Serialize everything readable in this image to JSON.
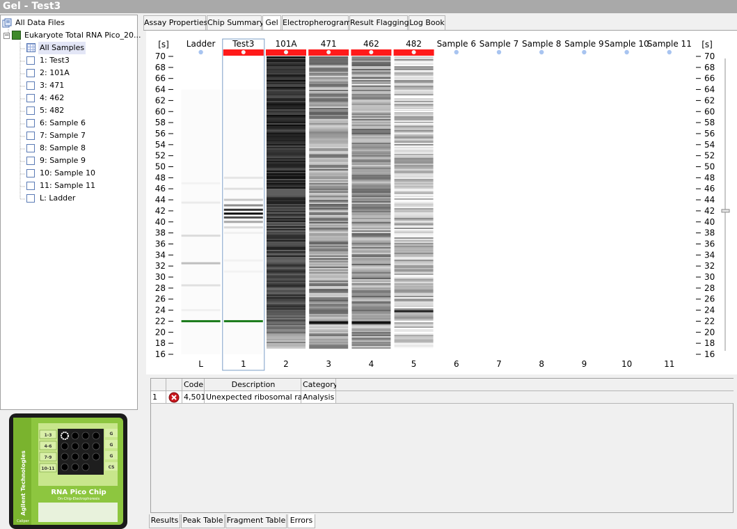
{
  "window": {
    "title": "Gel - Test3"
  },
  "tree": {
    "root": "All Data Files",
    "file": "Eukaryote Total RNA Pico_20...",
    "items": [
      "All Samples",
      "1: Test3",
      "2: 101A",
      "3: 471",
      "4: 462",
      "5: 482",
      "6: Sample 6",
      "7: Sample 7",
      "8: Sample 8",
      "9: Sample 9",
      "10: Sample 10",
      "11: Sample 11",
      "L: Ladder"
    ],
    "selected_index": 0
  },
  "chip": {
    "brand": "Agilent Technologies",
    "product": "RNA Pico Chip",
    "subtitle": "On-Chip-Electrophoresis",
    "maker": "Caliper",
    "well_labels": [
      "1-3",
      "4-6",
      "7-9",
      "10-11"
    ],
    "right_labels": [
      "G",
      "G",
      "G",
      "CS"
    ]
  },
  "top_tabs": [
    "Assay Properties",
    "Chip Summary",
    "Gel",
    "Electropherogram",
    "Result Flagging",
    "Log Book"
  ],
  "active_top_tab": "Gel",
  "gel": {
    "unit_label": "[s]",
    "y_range": [
      16,
      70
    ],
    "y_ticks": [
      70,
      68,
      66,
      64,
      62,
      60,
      58,
      56,
      54,
      52,
      50,
      48,
      46,
      44,
      42,
      40,
      38,
      36,
      34,
      32,
      30,
      28,
      26,
      24,
      22,
      20,
      18,
      16
    ],
    "slider_value": 42,
    "lanes": [
      {
        "name": "Ladder",
        "number": "L",
        "kind": "ladder",
        "flag": false,
        "marker_s": 22.0
      },
      {
        "name": "Test3",
        "number": "1",
        "kind": "sample",
        "flag": true,
        "selected": true,
        "marker_s": 22.0
      },
      {
        "name": "101A",
        "number": "2",
        "kind": "dense",
        "flag": true
      },
      {
        "name": "471",
        "number": "3",
        "kind": "medium",
        "flag": true
      },
      {
        "name": "462",
        "number": "4",
        "kind": "medium",
        "flag": true
      },
      {
        "name": "482",
        "number": "5",
        "kind": "light",
        "flag": true
      },
      {
        "name": "Sample 6",
        "number": "6",
        "kind": "empty",
        "flag": false
      },
      {
        "name": "Sample 7",
        "number": "7",
        "kind": "empty",
        "flag": false
      },
      {
        "name": "Sample 8",
        "number": "8",
        "kind": "empty",
        "flag": false
      },
      {
        "name": "Sample 9",
        "number": "9",
        "kind": "empty",
        "flag": false
      },
      {
        "name": "Sample 10",
        "number": "10",
        "kind": "empty",
        "flag": false
      },
      {
        "name": "Sample 11",
        "number": "11",
        "kind": "empty",
        "flag": false
      }
    ],
    "colors": {
      "flag": "#ff1a1a",
      "marker": "#1a7a1a",
      "dot": "#a8c4f0",
      "selection": "#7a9cc6"
    }
  },
  "errors_table": {
    "columns": [
      "",
      "",
      "Code",
      "Description",
      "Category"
    ],
    "rows": [
      {
        "index": "1",
        "icon": "error-icon",
        "code": "4,501",
        "description": "Unexpected ribosomal ratio.",
        "category": "Analysis"
      }
    ]
  },
  "bottom_tabs": [
    "Results",
    "Peak Table",
    "Fragment Table",
    "Errors"
  ],
  "active_bottom_tab": "Errors"
}
